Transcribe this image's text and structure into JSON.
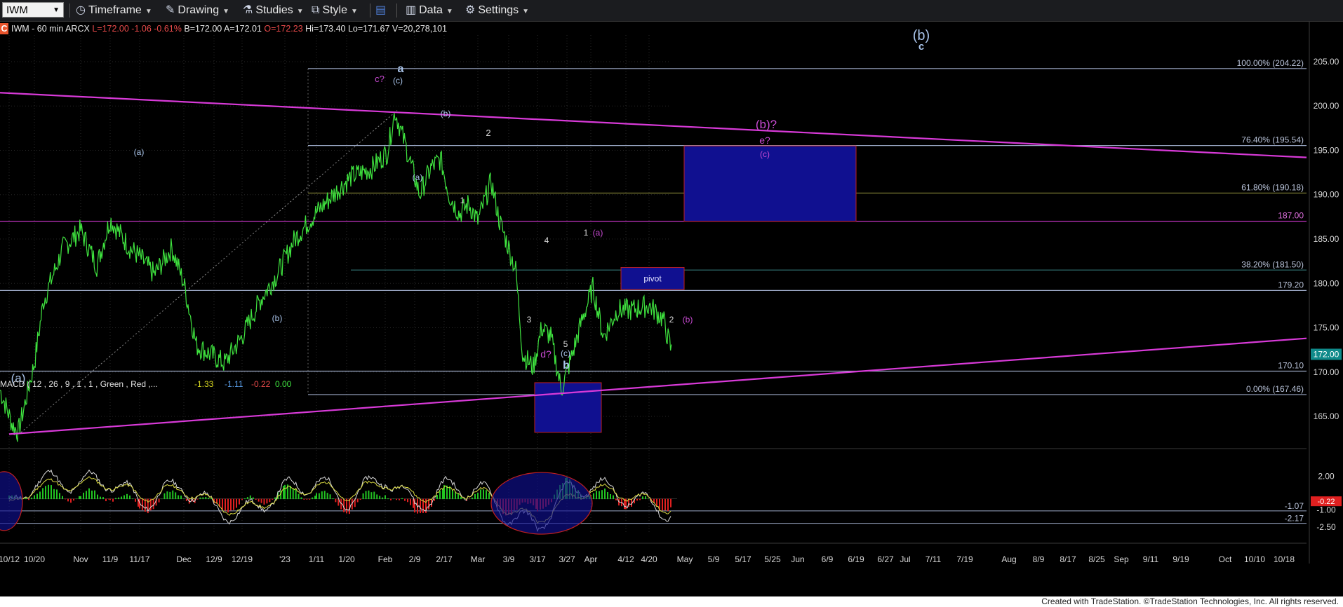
{
  "toolbar": {
    "symbol": "IWM",
    "timeframe_label": "Timeframe",
    "drawing_label": "Drawing",
    "studies_label": "Studies",
    "style_label": "Style",
    "data_label": "Data",
    "settings_label": "Settings"
  },
  "info_bar": {
    "badge": "C",
    "title": "IWM - 60 min  ARCX",
    "last": "L=172.00",
    "change": "-1.06",
    "change_pct": "-0.61%",
    "bid": "B=172.00",
    "ask": "A=172.01",
    "open": "O=172.23",
    "high": "Hi=173.40",
    "low": "Lo=171.67",
    "volume": "V=20,278,101"
  },
  "footer": {
    "credit": "Created with TradeStation. ©TradeStation Technologies, Inc. All rights reserved."
  },
  "colors": {
    "price": "#3fe33f",
    "channel": "#d83ad8",
    "fib": "#9aa7c4",
    "box": "#101090",
    "box_border": "#c02020",
    "label_blue": "#a9c4ea",
    "label_magenta": "#c94ad3"
  },
  "chart_data": [
    {
      "type": "line",
      "title": "IWM - 60 min ARCX",
      "x": [
        "10/12",
        "10/20",
        "Nov",
        "11/9",
        "11/17",
        "Dec",
        "12/9",
        "12/19",
        "'23",
        "1/11",
        "1/20",
        "Feb",
        "2/9",
        "2/17",
        "Mar",
        "3/9",
        "3/17",
        "3/27",
        "Apr",
        "4/12",
        "4/20"
      ],
      "series": [
        {
          "name": "IWM",
          "values": [
            165,
            171,
            184,
            187,
            183,
            185,
            179,
            171,
            178,
            184,
            188,
            199,
            191,
            192,
            188,
            184,
            171,
            169,
            175,
            178,
            172
          ]
        }
      ],
      "x_axis_ticks": [
        "10/12",
        "10/20",
        "Nov",
        "11/9",
        "11/17",
        "Dec",
        "12/9",
        "12/19",
        "'23",
        "1/11",
        "1/20",
        "Feb",
        "2/9",
        "2/17",
        "Mar",
        "3/9",
        "3/17",
        "3/27",
        "Apr",
        "4/12",
        "4/20",
        "May",
        "5/9",
        "5/17",
        "5/25",
        "Jun",
        "6/9",
        "6/19",
        "6/27",
        "Jul",
        "7/11",
        "7/19",
        "Aug",
        "8/9",
        "8/17",
        "8/25",
        "Sep",
        "9/11",
        "9/19",
        "Oct",
        "10/10",
        "10/18"
      ],
      "y_ticks": [
        165,
        170,
        175,
        180,
        185,
        190,
        195,
        200,
        205
      ],
      "ylim": [
        162,
        208
      ],
      "last_price_marker": "172.00",
      "horizontal_levels": [
        {
          "label": "100.00% (204.22)",
          "value": 204.22,
          "kind": "fib"
        },
        {
          "label": "76.40% (195.54)",
          "value": 195.54,
          "kind": "fib"
        },
        {
          "label": "61.80% (190.18)",
          "value": 190.18,
          "kind": "fib-gold"
        },
        {
          "label": "187.00",
          "value": 187.0,
          "kind": "magenta"
        },
        {
          "label": "38.20% (181.50)",
          "value": 181.5,
          "kind": "fib-teal"
        },
        {
          "label": "179.20",
          "value": 179.2,
          "kind": "fib"
        },
        {
          "label": "170.10",
          "value": 170.1,
          "kind": "fib"
        },
        {
          "label": "0.00% (167.46)",
          "value": 167.46,
          "kind": "fib"
        }
      ],
      "channel_lines": [
        {
          "from": [
            "start",
            201.5
          ],
          "to": [
            "end",
            194.2
          ]
        },
        {
          "from": [
            "10/12",
            163.0
          ],
          "to": [
            "end",
            173.8
          ]
        }
      ],
      "boxes": [
        {
          "name": "target-box",
          "x0": "5/1",
          "x1": "6/19",
          "y0": 187.0,
          "y1": 195.5
        },
        {
          "name": "pivot-box",
          "x0": "4/10",
          "x1": "5/1",
          "y0": 179.3,
          "y1": 181.8,
          "label": "pivot"
        },
        {
          "name": "support-box",
          "x0": "3/15",
          "x1": "4/1",
          "y0": 163.2,
          "y1": 168.8
        }
      ],
      "wave_labels": [
        {
          "text": "(b)",
          "color": "blue",
          "big": true
        },
        {
          "text": "c",
          "color": "blue",
          "bold": true
        },
        {
          "text": "a",
          "color": "blue",
          "bold": true
        },
        {
          "text": "c?",
          "color": "magenta"
        },
        {
          "text": "(c)",
          "color": "blue"
        },
        {
          "text": "(b)",
          "color": "blue"
        },
        {
          "text": "2",
          "color": "white"
        },
        {
          "text": "(a)",
          "color": "blue"
        },
        {
          "text": "(a)",
          "color": "blue"
        },
        {
          "text": "1",
          "color": "white"
        },
        {
          "text": "(b)?",
          "color": "magenta",
          "big": true
        },
        {
          "text": "e?",
          "color": "magenta"
        },
        {
          "text": "(c)",
          "color": "magenta"
        },
        {
          "text": "1",
          "color": "white"
        },
        {
          "text": "(a)",
          "color": "magenta"
        },
        {
          "text": "4",
          "color": "white"
        },
        {
          "text": "(b)",
          "color": "blue"
        },
        {
          "text": "3",
          "color": "white"
        },
        {
          "text": "2",
          "color": "white"
        },
        {
          "text": "(b)",
          "color": "magenta"
        },
        {
          "text": "5",
          "color": "white"
        },
        {
          "text": "(c)",
          "color": "blue"
        },
        {
          "text": "d?",
          "color": "magenta"
        },
        {
          "text": "b",
          "color": "blue",
          "bold": true
        },
        {
          "text": "(a)",
          "color": "blue",
          "big": true
        }
      ]
    },
    {
      "type": "line",
      "title": "MACD ( 12 , 26 , 9 , 1 , 1 , Green , Red ,...",
      "macd_values": [
        "-1.33",
        "-1.11",
        "-0.22",
        "0.00"
      ],
      "y_ticks": [
        "2.00",
        "-1.00",
        "-2.50"
      ],
      "levels": [
        {
          "label": "-1.07",
          "value": -1.07
        },
        {
          "label": "-2.17",
          "value": -2.17
        }
      ],
      "current_marker": "-0.22",
      "ylim": [
        -3.0,
        3.2
      ],
      "x": [
        "10/12",
        "10/20",
        "Nov",
        "11/9",
        "11/17",
        "Dec",
        "12/9",
        "12/19",
        "'23",
        "1/11",
        "1/20",
        "Feb",
        "2/9",
        "2/17",
        "Mar",
        "3/9",
        "3/17",
        "3/27",
        "Apr",
        "4/12",
        "4/20"
      ],
      "series": [
        {
          "name": "MACD",
          "values": [
            -1.0,
            1.6,
            1.4,
            1.7,
            -0.3,
            1.2,
            -0.9,
            -1.4,
            0.8,
            1.5,
            -0.2,
            2.0,
            -0.6,
            0.9,
            1.0,
            -1.5,
            -2.4,
            0.6,
            1.3,
            0.2,
            -1.2
          ]
        },
        {
          "name": "Signal",
          "values": [
            -0.8,
            1.1,
            1.3,
            1.4,
            0.2,
            0.9,
            -0.5,
            -1.1,
            0.4,
            1.2,
            0.3,
            1.5,
            0.2,
            0.5,
            0.7,
            -0.9,
            -1.9,
            -0.2,
            0.9,
            0.4,
            -0.9
          ]
        }
      ]
    }
  ]
}
